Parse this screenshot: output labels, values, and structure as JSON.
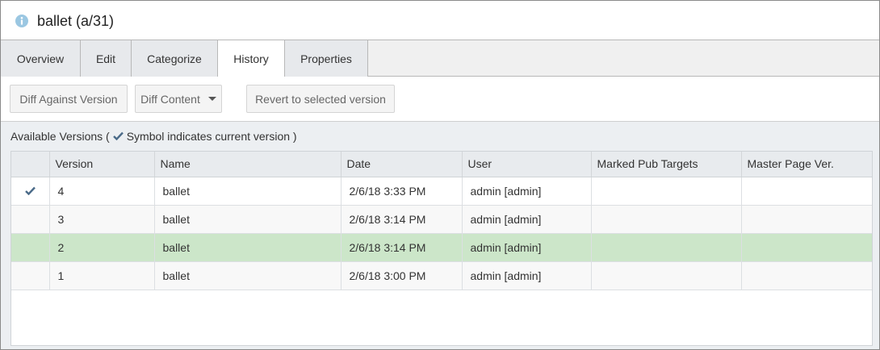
{
  "title": "ballet (a/31)",
  "tabs": [
    {
      "label": "Overview"
    },
    {
      "label": "Edit"
    },
    {
      "label": "Categorize"
    },
    {
      "label": "History"
    },
    {
      "label": "Properties"
    }
  ],
  "active_tab": "History",
  "toolbar": {
    "diff_against_version": "Diff Against Version",
    "diff_content": "Diff Content",
    "revert": "Revert to selected version"
  },
  "available_versions": {
    "prefix": "Available Versions (",
    "suffix": "Symbol indicates current version )"
  },
  "table": {
    "columns": [
      "",
      "Version",
      "Name",
      "Date",
      "User",
      "Marked Pub Targets",
      "Master Page Ver."
    ],
    "rows": [
      {
        "current": true,
        "version": "4",
        "name": "ballet",
        "date": "2/6/18 3:33 PM",
        "user": "admin [admin]",
        "pub_targets": "",
        "master_page_ver": ""
      },
      {
        "current": false,
        "version": "3",
        "name": "ballet",
        "date": "2/6/18 3:14 PM",
        "user": "admin [admin]",
        "pub_targets": "",
        "master_page_ver": ""
      },
      {
        "current": false,
        "version": "2",
        "name": "ballet",
        "date": "2/6/18 3:14 PM",
        "user": "admin [admin]",
        "pub_targets": "",
        "master_page_ver": "",
        "selected": true
      },
      {
        "current": false,
        "version": "1",
        "name": "ballet",
        "date": "2/6/18 3:00 PM",
        "user": "admin [admin]",
        "pub_targets": "",
        "master_page_ver": ""
      }
    ]
  },
  "colors": {
    "selected_row": "#cce6c9",
    "info_icon": "#9bc7e2",
    "check": "#4a6a88"
  }
}
